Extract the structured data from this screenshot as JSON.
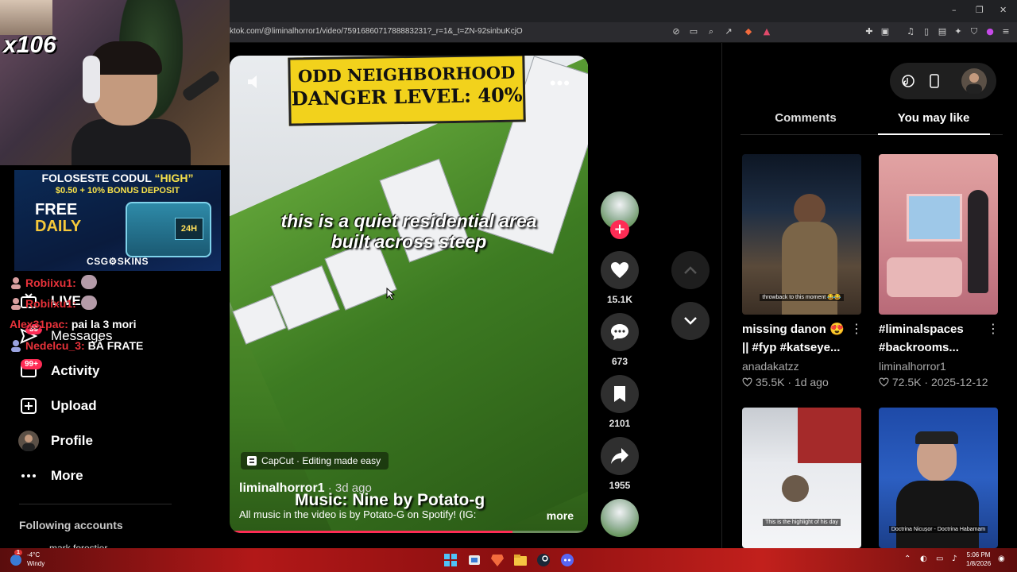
{
  "browser": {
    "url": "ktok.com/@liminalhorror1/video/7591686071788883231?_r=1&_t=ZN-92sinbuKcjO",
    "window_controls": [
      "–",
      "❐",
      "✕"
    ]
  },
  "stream_overlay": {
    "counter": "x106",
    "promo": {
      "line1_prefix": "FOLOSESTE CODUL ",
      "line1_code": "“HIGH”",
      "line2": "$0.50 + 10% BONUS DEPOSIT",
      "free": "FREE",
      "daily": "DAILY",
      "chest_badge": "24H",
      "brand": "CSG⚙SKINS"
    },
    "chat": [
      {
        "user": "Robiixu1:",
        "message": ""
      },
      {
        "user": "Robiixu1:",
        "message": ""
      },
      {
        "user": "Alex31pac:",
        "message": "pai la 3 mori"
      },
      {
        "user": "Nedelcu_3:",
        "message": "BĂ FRATE"
      }
    ]
  },
  "left_nav": {
    "items": [
      {
        "label": "LIVE",
        "icon": "live-icon"
      },
      {
        "label": "Messages",
        "icon": "messages-icon",
        "badge": "39"
      },
      {
        "label": "Activity",
        "icon": "activity-icon",
        "badge": "99+"
      },
      {
        "label": "Upload",
        "icon": "upload-icon"
      },
      {
        "label": "Profile",
        "icon": "profile-avatar"
      },
      {
        "label": "More",
        "icon": "more-icon"
      }
    ],
    "following_title": "Following accounts",
    "following_partial": "mark.forestier"
  },
  "video": {
    "banner_line1": "ODD NEIGHBORHOOD",
    "banner_line2": "DANGER LEVEL: 40%",
    "caption_line1": "this is a quiet residential area",
    "caption_line2": "built across steep",
    "capcut": "CapCut · Editing made easy",
    "author": "liminalhorror1",
    "ago": " · 3d ago",
    "music_overlay": "Music: Nine by Potato-g",
    "description": "All music in the video is by Potato-G on Spotify! (IG:",
    "more": "more",
    "progress": 0.79
  },
  "actions": {
    "likes": "15.1K",
    "comments": "673",
    "saves": "2101",
    "shares": "1955"
  },
  "right_panel": {
    "tabs": [
      "Comments",
      "You may like"
    ],
    "active_tab": "You may like",
    "cards": [
      {
        "title_l1": "missing danon 😍",
        "title_l2": "|| #fyp #katseye...",
        "author": "anadakatzz",
        "likes": "35.5K",
        "date": "1d ago",
        "thumb_caption": "throwback to this moment 😂😂"
      },
      {
        "title_l1": "#liminalspaces",
        "title_l2": "#backrooms...",
        "author": "liminalhorror1",
        "likes": "72.5K",
        "date": "2025-12-12",
        "thumb_caption": ""
      },
      {
        "title_l1": "",
        "title_l2": "",
        "author": "",
        "likes": "",
        "date": "",
        "thumb_caption": "This is the highlight of his day"
      },
      {
        "title_l1": "",
        "title_l2": "",
        "author": "",
        "likes": "",
        "date": "",
        "thumb_caption": "Doctrina Nicușor - Doctrina Habamam"
      }
    ]
  },
  "taskbar": {
    "temperature": "-4°C",
    "weather": "Windy",
    "time": "5:06 PM",
    "date": "1/8/2026",
    "notif": "1"
  },
  "colors": {
    "tiktok_red": "#fe2c55",
    "bg": "#000000",
    "taskbar": "#b21818"
  }
}
